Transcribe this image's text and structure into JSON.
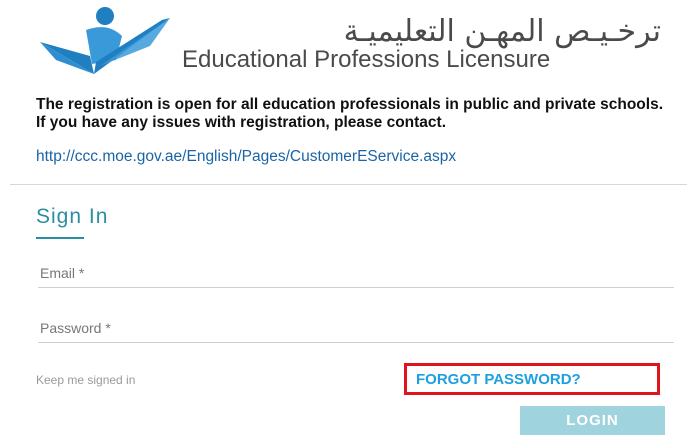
{
  "header": {
    "title_arabic": "ترخـيـص المهـن التعليميـة",
    "title_english": "Educational Professions Licensure",
    "logo_icon": "figure-checkmark-logo-icon"
  },
  "notice": {
    "text": "The registration is open for all education professionals in public and private schools. If you have any issues with registration, please contact.",
    "link": "http://ccc.moe.gov.ae/English/Pages/CustomerEService.aspx"
  },
  "signin": {
    "title": "Sign In",
    "email_placeholder": "Email *",
    "password_placeholder": "Password *",
    "keep_signed_in": "Keep me signed in",
    "forgot_password": "FORGOT PASSWORD?",
    "login_button": "LOGIN"
  },
  "colors": {
    "accent_teal": "#2a8fa0",
    "link_blue": "#1a64a6",
    "forgot_blue": "#1e9fe0",
    "highlight_red": "#e0141b",
    "button_fill": "#9fd4df"
  }
}
